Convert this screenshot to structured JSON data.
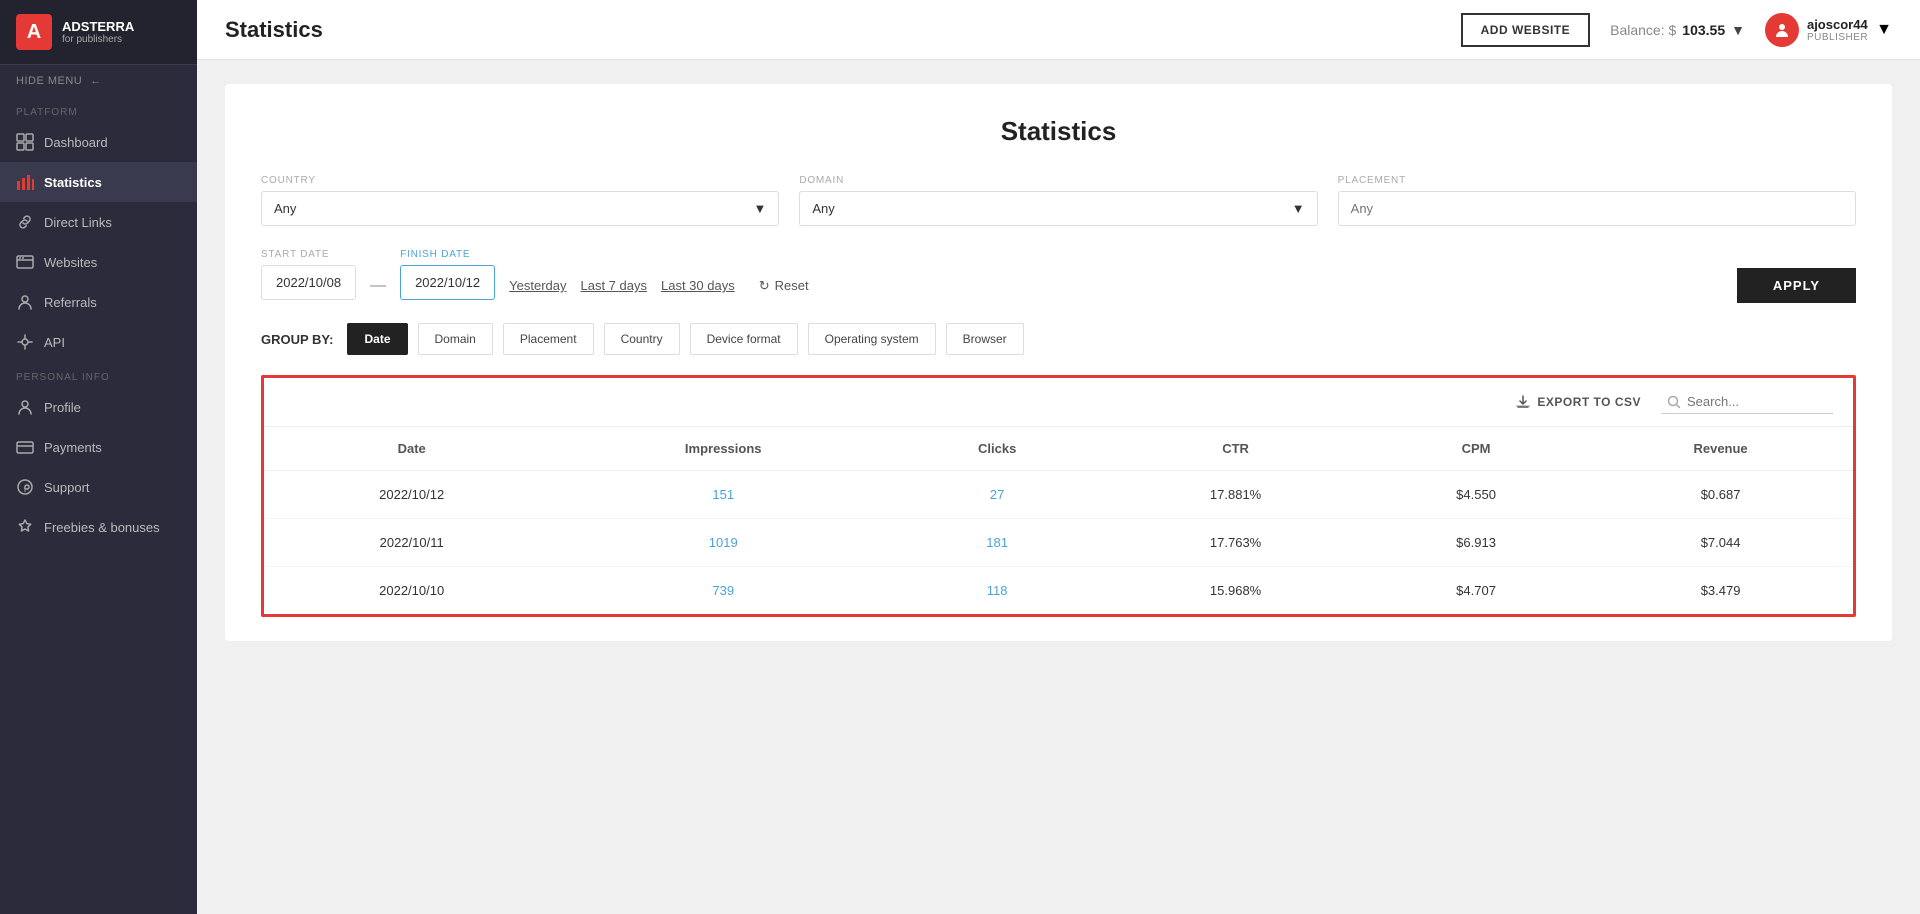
{
  "app": {
    "logo_main": "ADSTERRA",
    "logo_sub": "for publishers"
  },
  "sidebar": {
    "hide_menu": "HIDE MENU",
    "platform_label": "PLATFORM",
    "personal_label": "PERSONAL INFO",
    "items": [
      {
        "id": "dashboard",
        "label": "Dashboard",
        "icon": "dashboard-icon"
      },
      {
        "id": "statistics",
        "label": "Statistics",
        "icon": "statistics-icon",
        "active": true
      },
      {
        "id": "direct-links",
        "label": "Direct Links",
        "icon": "direct-links-icon"
      },
      {
        "id": "websites",
        "label": "Websites",
        "icon": "websites-icon"
      },
      {
        "id": "referrals",
        "label": "Referrals",
        "icon": "referrals-icon"
      },
      {
        "id": "api",
        "label": "API",
        "icon": "api-icon"
      }
    ],
    "personal_items": [
      {
        "id": "profile",
        "label": "Profile",
        "icon": "profile-icon"
      },
      {
        "id": "payments",
        "label": "Payments",
        "icon": "payments-icon"
      },
      {
        "id": "support",
        "label": "Support",
        "icon": "support-icon"
      },
      {
        "id": "freebies",
        "label": "Freebies & bonuses",
        "icon": "freebies-icon"
      }
    ]
  },
  "topbar": {
    "title": "Statistics",
    "add_website_label": "ADD WEBSITE",
    "balance_label": "Balance: $",
    "balance_value": "103.55",
    "username": "ajoscor44",
    "user_role": "PUBLISHER"
  },
  "filters": {
    "country_label": "COUNTRY",
    "country_value": "Any",
    "domain_label": "DOMAIN",
    "domain_value": "Any",
    "placement_label": "PLACEMENT",
    "placement_placeholder": "Any",
    "start_date_label": "START DATE",
    "start_date_value": "2022/10/08",
    "finish_date_label": "FINISH DATE",
    "finish_date_value": "2022/10/12",
    "yesterday_label": "Yesterday",
    "last7_label": "Last 7 days",
    "last30_label": "Last 30 days",
    "reset_label": "Reset",
    "apply_label": "APPLY"
  },
  "group_by": {
    "label": "GROUP BY:",
    "tabs": [
      {
        "id": "date",
        "label": "Date",
        "active": true
      },
      {
        "id": "domain",
        "label": "Domain",
        "active": false
      },
      {
        "id": "placement",
        "label": "Placement",
        "active": false
      },
      {
        "id": "country",
        "label": "Country",
        "active": false
      },
      {
        "id": "device-format",
        "label": "Device format",
        "active": false
      },
      {
        "id": "os",
        "label": "Operating system",
        "active": false
      },
      {
        "id": "browser",
        "label": "Browser",
        "active": false
      }
    ]
  },
  "table": {
    "export_label": "EXPORT TO CSV",
    "search_placeholder": "Search...",
    "columns": [
      "Date",
      "Impressions",
      "Clicks",
      "CTR",
      "CPM",
      "Revenue"
    ],
    "rows": [
      {
        "date": "2022/10/12",
        "impressions": "151",
        "clicks": "27",
        "ctr": "17.881%",
        "cpm": "$4.550",
        "revenue": "$0.687"
      },
      {
        "date": "2022/10/11",
        "impressions": "1019",
        "clicks": "181",
        "ctr": "17.763%",
        "cpm": "$6.913",
        "revenue": "$7.044"
      },
      {
        "date": "2022/10/10",
        "impressions": "739",
        "clicks": "118",
        "ctr": "15.968%",
        "cpm": "$4.707",
        "revenue": "$3.479"
      }
    ]
  },
  "card_title": "Statistics"
}
